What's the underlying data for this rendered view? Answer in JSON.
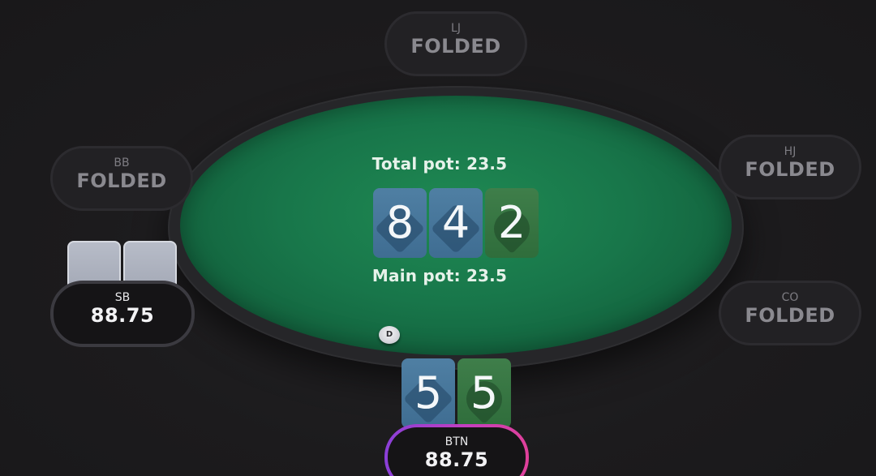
{
  "pot": {
    "total_label": "Total pot: 23.5",
    "main_label": "Main pot: 23.5"
  },
  "board": [
    {
      "rank": "8",
      "suit": "diamonds",
      "color": "#4a7aa0"
    },
    {
      "rank": "4",
      "suit": "diamonds",
      "color": "#4a7aa0"
    },
    {
      "rank": "2",
      "suit": "clubs",
      "color": "#3a7a45"
    }
  ],
  "hero": {
    "position": "BTN",
    "stack": "88.75",
    "cards": [
      {
        "rank": "5",
        "suit": "diamonds",
        "color": "#4a7aa0"
      },
      {
        "rank": "5",
        "suit": "clubs",
        "color": "#3a7a45"
      }
    ],
    "ring_gradient": [
      "#8a3fd8",
      "#e0409a"
    ]
  },
  "seats": {
    "lj": {
      "position": "LJ",
      "status": "FOLDED"
    },
    "hj": {
      "position": "HJ",
      "status": "FOLDED"
    },
    "co": {
      "position": "CO",
      "status": "FOLDED"
    },
    "bb": {
      "position": "BB",
      "status": "FOLDED"
    },
    "sb": {
      "position": "SB",
      "status": "88.75"
    }
  },
  "dealer_button": {
    "label": "D",
    "icon": "dealer-button-icon"
  },
  "colors": {
    "felt": "#18764a",
    "background": "#1c1b1d"
  }
}
